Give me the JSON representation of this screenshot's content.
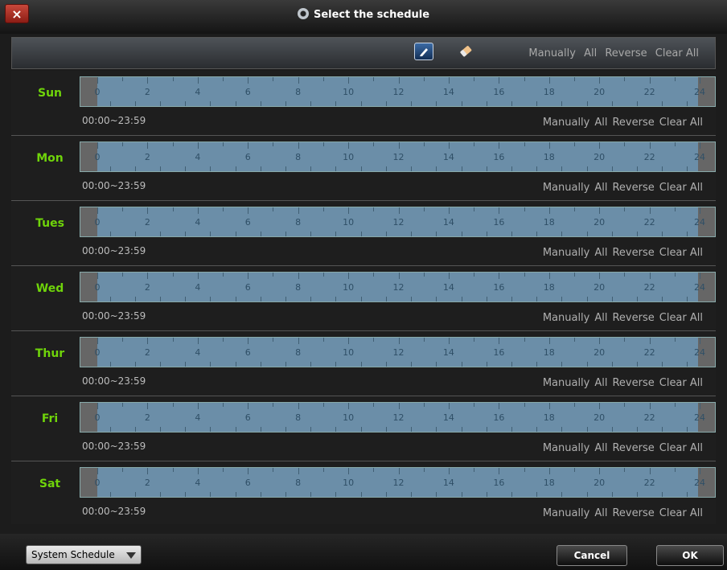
{
  "window": {
    "title": "Select the schedule",
    "close_label": "×"
  },
  "toolbar": {
    "links": [
      "Manually",
      "All",
      "Reverse",
      "Clear All"
    ]
  },
  "timeline": {
    "ticks": [
      "0",
      "2",
      "4",
      "6",
      "8",
      "10",
      "12",
      "14",
      "16",
      "18",
      "20",
      "22",
      "24"
    ]
  },
  "days": [
    {
      "name": "Sun",
      "range": "00:00~23:59"
    },
    {
      "name": "Mon",
      "range": "00:00~23:59"
    },
    {
      "name": "Tues",
      "range": "00:00~23:59"
    },
    {
      "name": "Wed",
      "range": "00:00~23:59"
    },
    {
      "name": "Thur",
      "range": "00:00~23:59"
    },
    {
      "name": "Fri",
      "range": "00:00~23:59"
    },
    {
      "name": "Sat",
      "range": "00:00~23:59"
    }
  ],
  "row_links": [
    "Manually",
    "All",
    "Reverse",
    "Clear All"
  ],
  "footer": {
    "system_schedule_label": "System Schedule",
    "cancel_label": "Cancel",
    "ok_label": "OK"
  },
  "colors": {
    "day_label": "#6fd40a",
    "bar": "#6b8ea8"
  }
}
